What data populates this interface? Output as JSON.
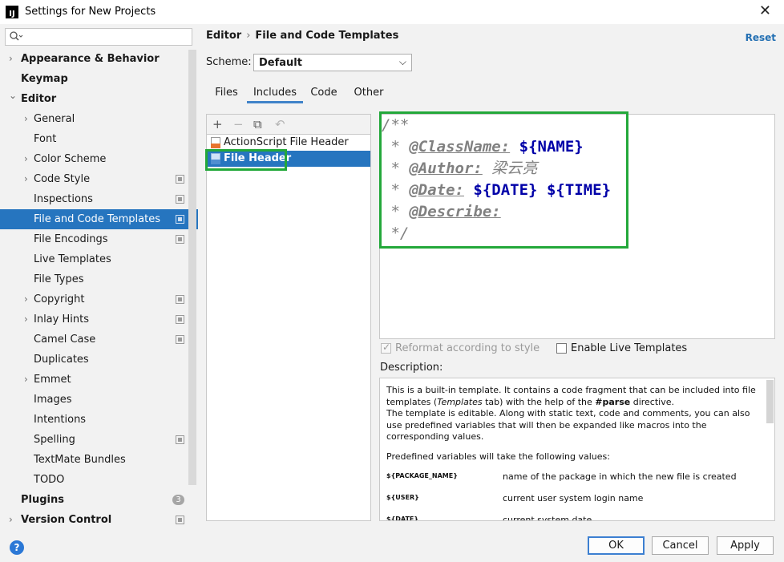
{
  "window": {
    "title": "Settings for New Projects",
    "app_icon_text": "IJ",
    "close_glyph": "✕"
  },
  "search": {
    "icon": "search-icon",
    "value": ""
  },
  "sidebar": {
    "items": [
      {
        "label": "Appearance & Behavior",
        "arrow": "›"
      },
      {
        "label": "Keymap",
        "arrow": ""
      },
      {
        "label": "Editor",
        "arrow": "⌄"
      },
      {
        "label": "General",
        "arrow": "›"
      },
      {
        "label": "Font",
        "arrow": ""
      },
      {
        "label": "Color Scheme",
        "arrow": "›"
      },
      {
        "label": "Code Style",
        "arrow": "›"
      },
      {
        "label": "Inspections",
        "arrow": ""
      },
      {
        "label": "File and Code Templates",
        "arrow": ""
      },
      {
        "label": "File Encodings",
        "arrow": ""
      },
      {
        "label": "Live Templates",
        "arrow": ""
      },
      {
        "label": "File Types",
        "arrow": ""
      },
      {
        "label": "Copyright",
        "arrow": "›"
      },
      {
        "label": "Inlay Hints",
        "arrow": "›"
      },
      {
        "label": "Camel Case",
        "arrow": ""
      },
      {
        "label": "Duplicates",
        "arrow": ""
      },
      {
        "label": "Emmet",
        "arrow": "›"
      },
      {
        "label": "Images",
        "arrow": ""
      },
      {
        "label": "Intentions",
        "arrow": ""
      },
      {
        "label": "Spelling",
        "arrow": ""
      },
      {
        "label": "TextMate Bundles",
        "arrow": ""
      },
      {
        "label": "TODO",
        "arrow": ""
      },
      {
        "label": "Plugins",
        "arrow": "",
        "badge": "3"
      },
      {
        "label": "Version Control",
        "arrow": "›"
      }
    ]
  },
  "header": {
    "crumb_1": "Editor",
    "separator": "›",
    "crumb_2": "File and Code Templates",
    "reset": "Reset"
  },
  "scheme": {
    "label": "Scheme:",
    "value": "Default",
    "caret": "⌵"
  },
  "tabs": [
    {
      "label": "Files"
    },
    {
      "label": "Includes"
    },
    {
      "label": "Code"
    },
    {
      "label": "Other"
    }
  ],
  "toolbar": {
    "add": "+",
    "remove": "−",
    "copy": "⧉",
    "revert": "↶"
  },
  "templates": [
    {
      "label": "ActionScript File Header",
      "icon_text": "AS"
    },
    {
      "label": "File Header",
      "icon_text": "J"
    }
  ],
  "editor": {
    "lines": [
      {
        "c1": "/**"
      },
      {
        "c1": " * ",
        "tag": "@ClassName:",
        "v1": "${NAME}"
      },
      {
        "c1": " * ",
        "tag": "@Author:",
        "c2": "梁云亮"
      },
      {
        "c1": " * ",
        "tag": "@Date:",
        "v1": "${DATE}",
        "v2": "${TIME}"
      },
      {
        "c1": " * ",
        "tag": "@Describe:"
      },
      {
        "c1": " */"
      }
    ]
  },
  "options": {
    "reformat": "Reformat according to style",
    "live_templates": "Enable Live Templates"
  },
  "description": {
    "label": "Description:",
    "p1_a": "This is a built-in template. It contains a code fragment that can be included into file templates (",
    "p1_b": "Templates",
    "p1_c": " tab) with the help of the ",
    "p1_d": "#parse",
    "p1_e": " directive.",
    "p1_f": "The template is editable. Along with static text, code and comments, you can also use predefined variables that will then be expanded like macros into the corresponding values.",
    "p2": "Predefined variables will take the following values:",
    "variables": [
      {
        "name": "${PACKAGE_NAME}",
        "desc": "name of the package in which the new file is created"
      },
      {
        "name": "${USER}",
        "desc": "current user system login name"
      },
      {
        "name": "${DATE}",
        "desc": "current system date"
      }
    ]
  },
  "buttons": {
    "help": "?",
    "ok": "OK",
    "cancel": "Cancel",
    "apply": "Apply"
  }
}
